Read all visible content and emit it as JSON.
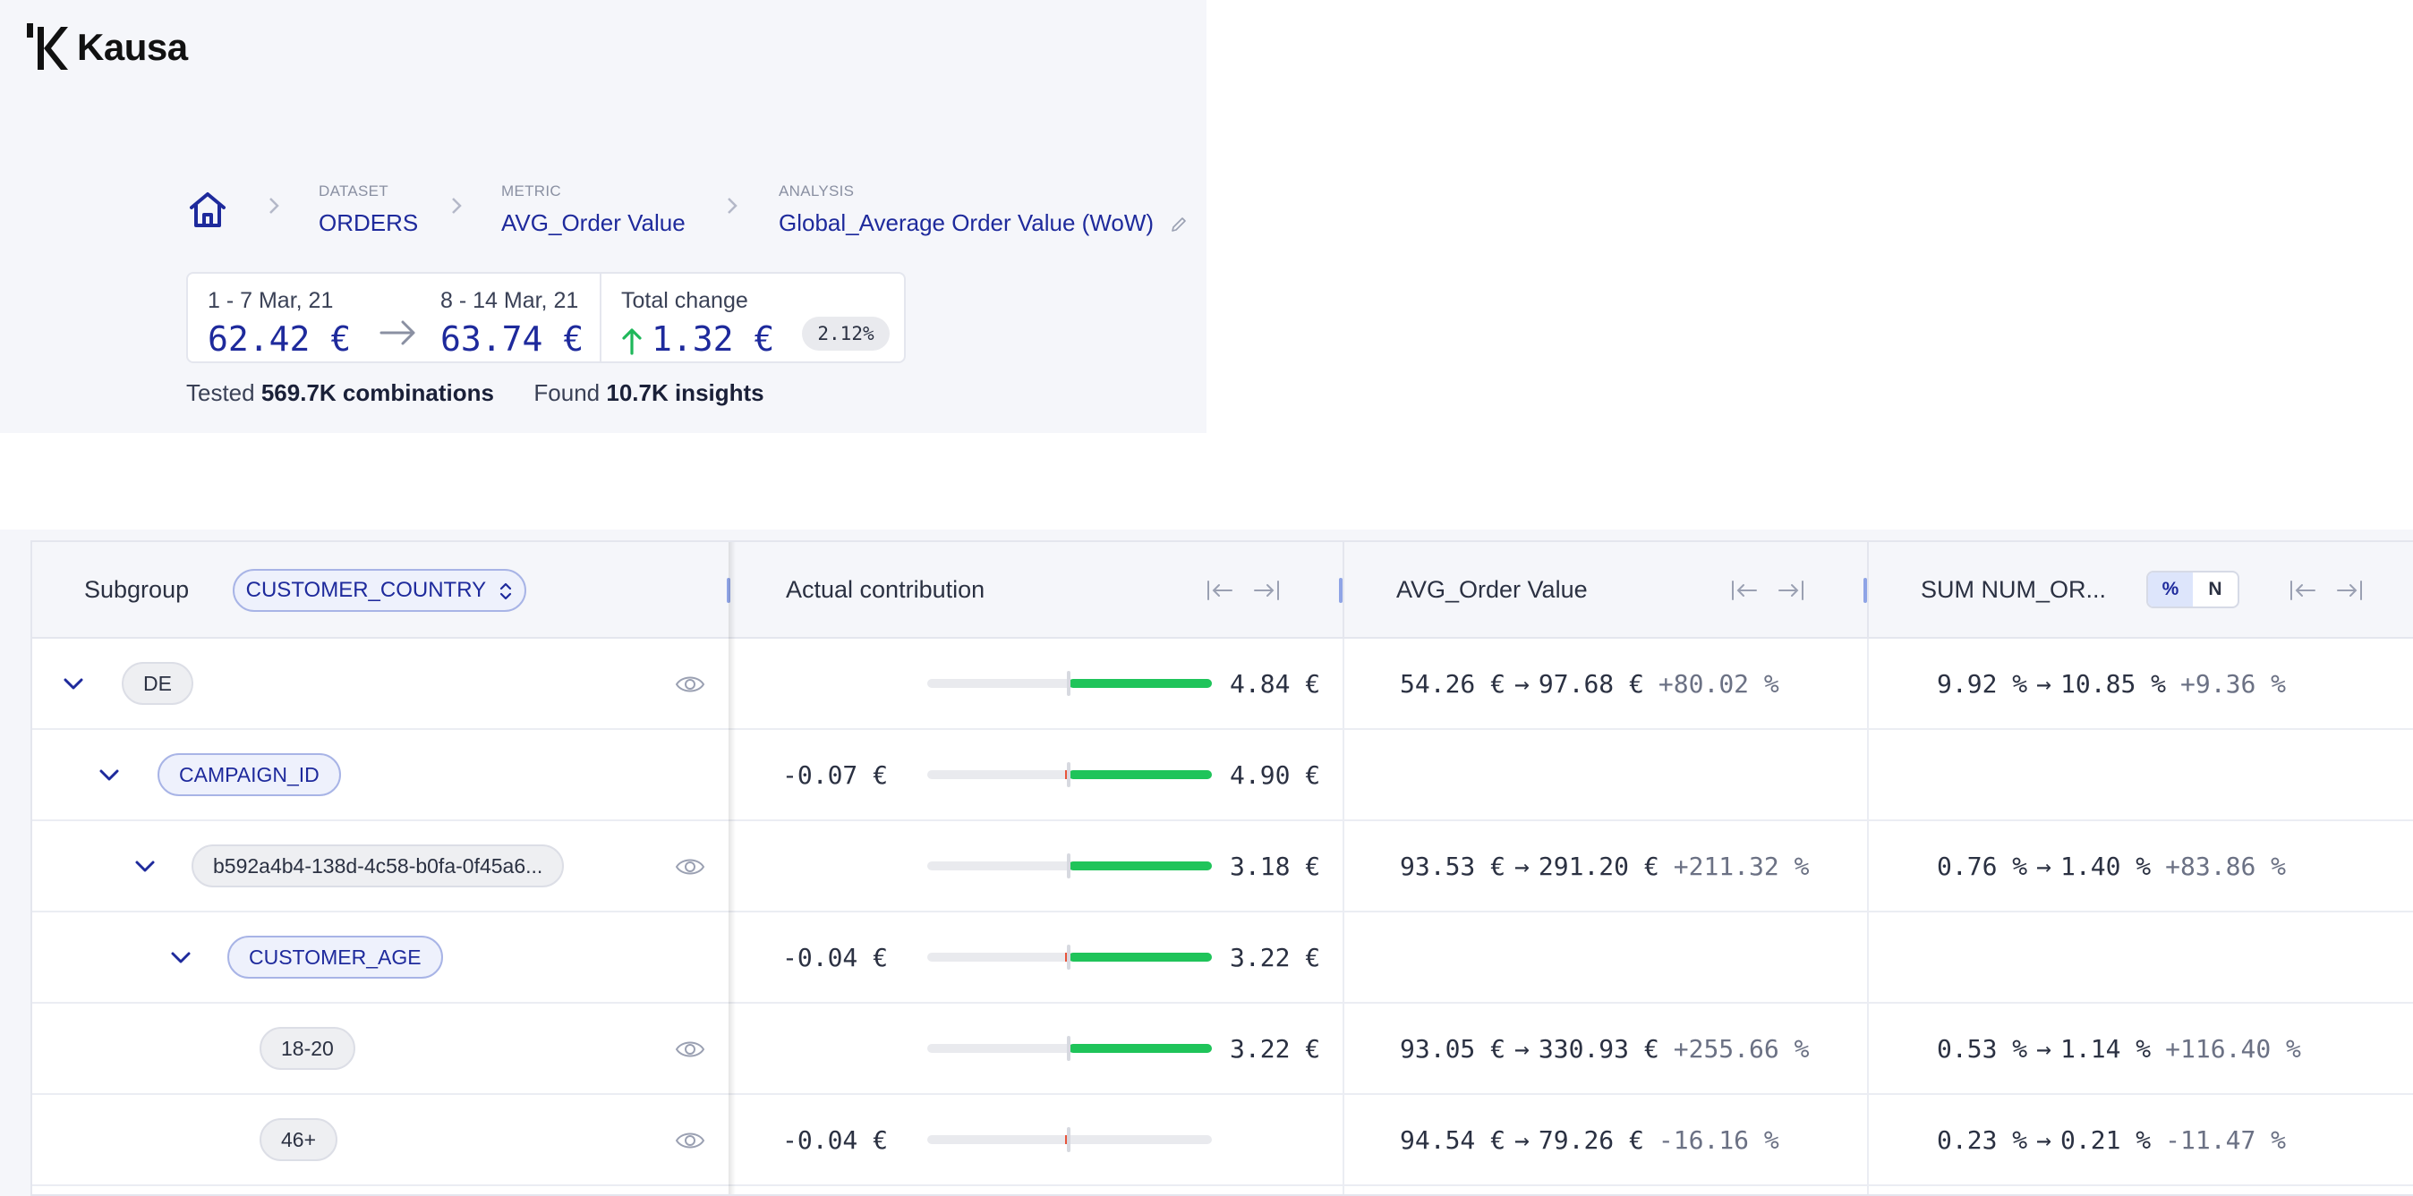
{
  "app": {
    "name": "Kausa",
    "logo_icon": "kausa-k-logo"
  },
  "breadcrumb": {
    "dataset": {
      "label": "DATASET",
      "value": "ORDERS"
    },
    "metric": {
      "label": "METRIC",
      "value": "AVG_Order Value"
    },
    "analysis": {
      "label": "ANALYSIS",
      "value": "Global_Average Order Value (WoW)"
    }
  },
  "summary": {
    "period1": {
      "label": "1 - 7 Mar, 21",
      "value": "62.42 €"
    },
    "period2": {
      "label": "8 - 14 Mar, 21",
      "value": "63.74 €"
    },
    "total_change": {
      "label": "Total change",
      "value": "1.32 €",
      "percent": "2.12%",
      "direction": "up"
    }
  },
  "stats": {
    "tested_prefix": "Tested",
    "tested_value": "569.7K combinations",
    "found_prefix": "Found",
    "found_value": "10.7K insights"
  },
  "table": {
    "columns": {
      "subgroup": {
        "title": "Subgroup",
        "group_by": "CUSTOMER_COUNTRY"
      },
      "contribution": {
        "title": "Actual contribution"
      },
      "avg_order_value": {
        "title": "AVG_Order Value"
      },
      "sum_num_orders": {
        "title": "SUM NUM_OR...",
        "toggle": [
          "%",
          "N"
        ],
        "toggle_active": "%"
      }
    },
    "rows": [
      {
        "label": "DE",
        "kind": "value",
        "negative": "",
        "negative_value": 0,
        "positive": "4.84 €",
        "positive_value": 4.84,
        "aov": {
          "from": "54.26 €",
          "to": "97.68 €",
          "change": "+80.02 %"
        },
        "orders": {
          "from": "9.92 %",
          "to": "10.85 %",
          "change": "+9.36 %"
        }
      },
      {
        "label": "CAMPAIGN_ID",
        "kind": "dimension",
        "negative": "-0.07 €",
        "negative_value": -0.07,
        "positive": "4.90 €",
        "positive_value": 4.9,
        "aov": null,
        "orders": null
      },
      {
        "label": "b592a4b4-138d-4c58-b0fa-0f45a6...",
        "kind": "value",
        "negative": "",
        "negative_value": 0,
        "positive": "3.18 €",
        "positive_value": 3.18,
        "aov": {
          "from": "93.53 €",
          "to": "291.20 €",
          "change": "+211.32 %"
        },
        "orders": {
          "from": "0.76 %",
          "to": "1.40 %",
          "change": "+83.86 %"
        }
      },
      {
        "label": "CUSTOMER_AGE",
        "kind": "dimension",
        "negative": "-0.04 €",
        "negative_value": -0.04,
        "positive": "3.22 €",
        "positive_value": 3.22,
        "aov": null,
        "orders": null
      },
      {
        "label": "18-20",
        "kind": "value",
        "negative": "",
        "negative_value": 0,
        "positive": "3.22 €",
        "positive_value": 3.22,
        "aov": {
          "from": "93.05 €",
          "to": "330.93 €",
          "change": "+255.66 %"
        },
        "orders": {
          "from": "0.53 %",
          "to": "1.14 %",
          "change": "+116.40 %"
        }
      },
      {
        "label": "46+",
        "kind": "value",
        "negative": "-0.04 €",
        "negative_value": -0.04,
        "positive": "",
        "positive_value": 0,
        "aov": {
          "from": "94.54 €",
          "to": "79.26 €",
          "change": "-16.16 %"
        },
        "orders": {
          "from": "0.23 %",
          "to": "0.21 %",
          "change": "-11.47 %"
        }
      }
    ]
  },
  "colors": {
    "accent": "#1e2a9c",
    "positive_bar": "#1fc45a",
    "negative_bar": "#e8543a",
    "up_arrow": "#1fb85a"
  }
}
